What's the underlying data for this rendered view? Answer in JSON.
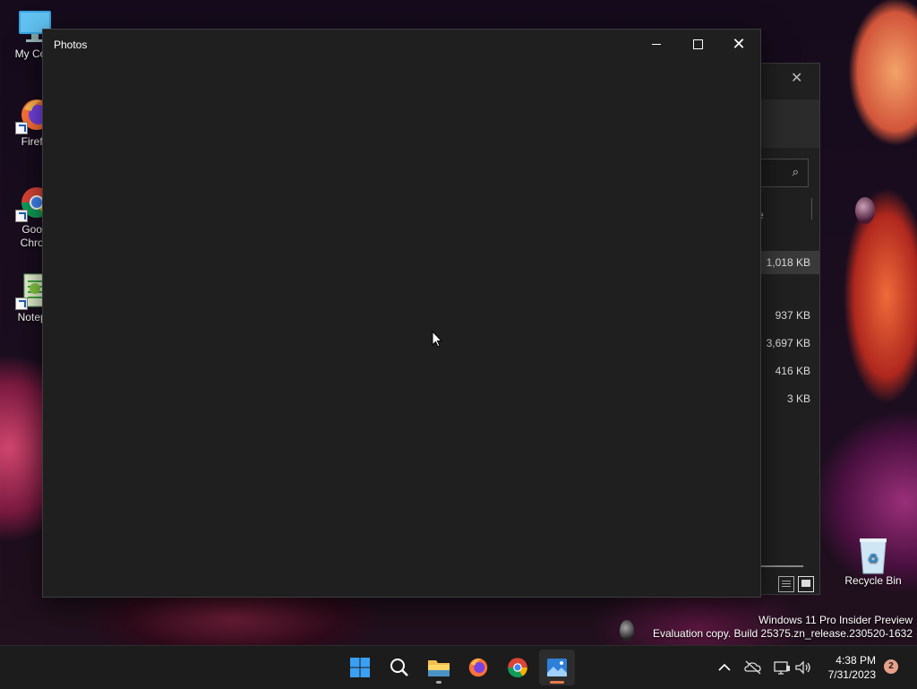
{
  "desktop": {
    "icons": [
      {
        "label": "My Com",
        "icon": "computer-icon"
      },
      {
        "label": "Firefo",
        "icon": "firefox-icon"
      },
      {
        "label": "Goog\nChron",
        "line1": "Goog",
        "line2": "Chron",
        "icon": "chrome-icon"
      },
      {
        "label": "Notepa",
        "icon": "notepad-icon"
      },
      {
        "label": "Recycle Bin",
        "icon": "recycle-bin-icon"
      }
    ]
  },
  "explorer": {
    "column_partial": "e",
    "rows": [
      {
        "size": "1,018 KB",
        "selected": true
      },
      {
        "size": "937 KB"
      },
      {
        "size": "3,697 KB"
      },
      {
        "size": "416 KB"
      },
      {
        "size": "3 KB"
      }
    ]
  },
  "photos_window": {
    "title": "Photos",
    "controls": {
      "minimize": "minimize",
      "maximize": "maximize",
      "close": "close"
    }
  },
  "watermark": {
    "line1": "Windows 11 Pro Insider Preview",
    "line2": "Evaluation copy. Build 25375.zn_release.230520-1632"
  },
  "taskbar": {
    "apps": [
      {
        "name": "start",
        "icon": "windows-start-icon"
      },
      {
        "name": "search",
        "icon": "search-icon"
      },
      {
        "name": "file-explorer",
        "icon": "folder-icon",
        "running": true
      },
      {
        "name": "firefox",
        "icon": "firefox-icon"
      },
      {
        "name": "chrome",
        "icon": "chrome-icon"
      },
      {
        "name": "photos",
        "icon": "photos-icon",
        "active": true
      }
    ],
    "tray": {
      "time": "4:38 PM",
      "date": "7/31/2023",
      "notification_count": "2"
    }
  },
  "colors": {
    "accent": "#0078d4",
    "photos_indicator": "#e8794c",
    "window_bg": "#1f1f1f",
    "taskbar_bg": "#1c1c1c"
  }
}
